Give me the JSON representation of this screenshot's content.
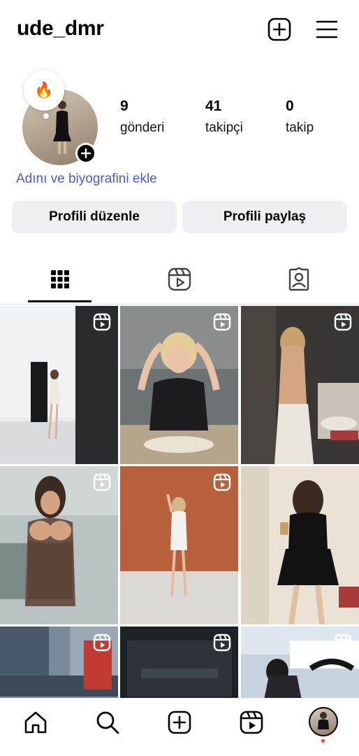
{
  "header": {
    "username": "ude_dmr",
    "icons": [
      "add-post-icon",
      "hamburger-menu-icon"
    ]
  },
  "profile": {
    "note_emoji": "🔥",
    "stats": {
      "posts": {
        "value": "9",
        "label": "gönderi"
      },
      "followers": {
        "value": "41",
        "label": "takipçi"
      },
      "following": {
        "value": "0",
        "label": "takip"
      }
    },
    "bio_prompt": "Adını ve biyografini ekle",
    "buttons": {
      "edit": "Profili düzenle",
      "share": "Profili paylaş"
    }
  },
  "tabs": [
    {
      "icon": "grid-icon",
      "active": true
    },
    {
      "icon": "reels-icon",
      "active": false
    },
    {
      "icon": "tagged-icon",
      "active": false
    }
  ],
  "grid": {
    "items": [
      {
        "type": "reel",
        "scene": "studio, white dress"
      },
      {
        "type": "reel",
        "scene": "blonde, black crop top"
      },
      {
        "type": "reel",
        "scene": "bathroom, backless dress"
      },
      {
        "type": "reel",
        "scene": "brown mini dress"
      },
      {
        "type": "reel",
        "scene": "terracotta wall, white dress"
      },
      {
        "type": "reel",
        "scene": "mirror selfie, black dress"
      },
      {
        "type": "reel",
        "scene": "city street"
      },
      {
        "type": "reel",
        "scene": "night storefront"
      },
      {
        "type": "reel",
        "scene": "yacht harbor"
      }
    ]
  },
  "bottom_nav": {
    "items": [
      "home-icon",
      "search-icon",
      "create-icon",
      "reels-icon",
      "profile-avatar"
    ],
    "notification_dot_color": "#ff3040"
  },
  "colors": {
    "link": "#4a5ae8",
    "button_bg": "#eff0f3"
  }
}
